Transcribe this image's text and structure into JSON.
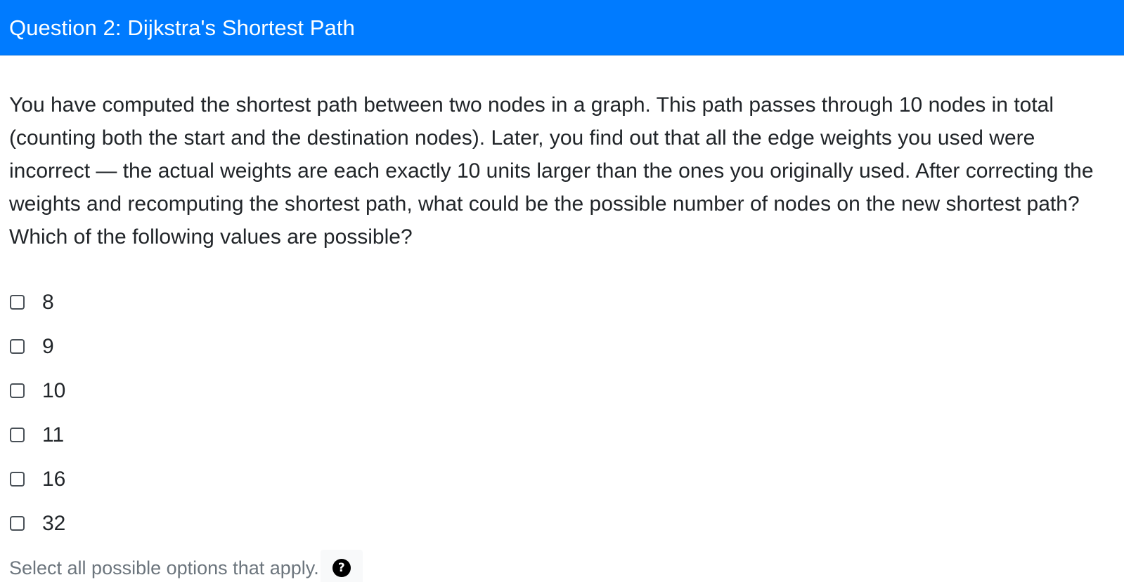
{
  "header": {
    "title": "Question 2: Dijkstra's Shortest Path"
  },
  "question": {
    "text": "You have computed the shortest path between two nodes in a graph. This path passes through 10 nodes in total (counting both the start and the destination nodes). Later, you find out that all the edge weights you used were incorrect — the actual weights are each exactly 10 units larger than the ones you originally used. After correcting the weights and recomputing the shortest path, what could be the possible number of nodes on the new shortest path? Which of the following values are possible?"
  },
  "options": [
    {
      "label": "8",
      "checked": false
    },
    {
      "label": "9",
      "checked": false
    },
    {
      "label": "10",
      "checked": false
    },
    {
      "label": "11",
      "checked": false
    },
    {
      "label": "16",
      "checked": false
    },
    {
      "label": "32",
      "checked": false
    }
  ],
  "help": {
    "text": "Select all possible options that apply.",
    "icon": "question-circle-icon",
    "icon_glyph": "?"
  },
  "colors": {
    "header_bg": "#007bff",
    "header_text": "#ffffff",
    "body_text": "#212529",
    "muted_text": "#6c757d"
  }
}
